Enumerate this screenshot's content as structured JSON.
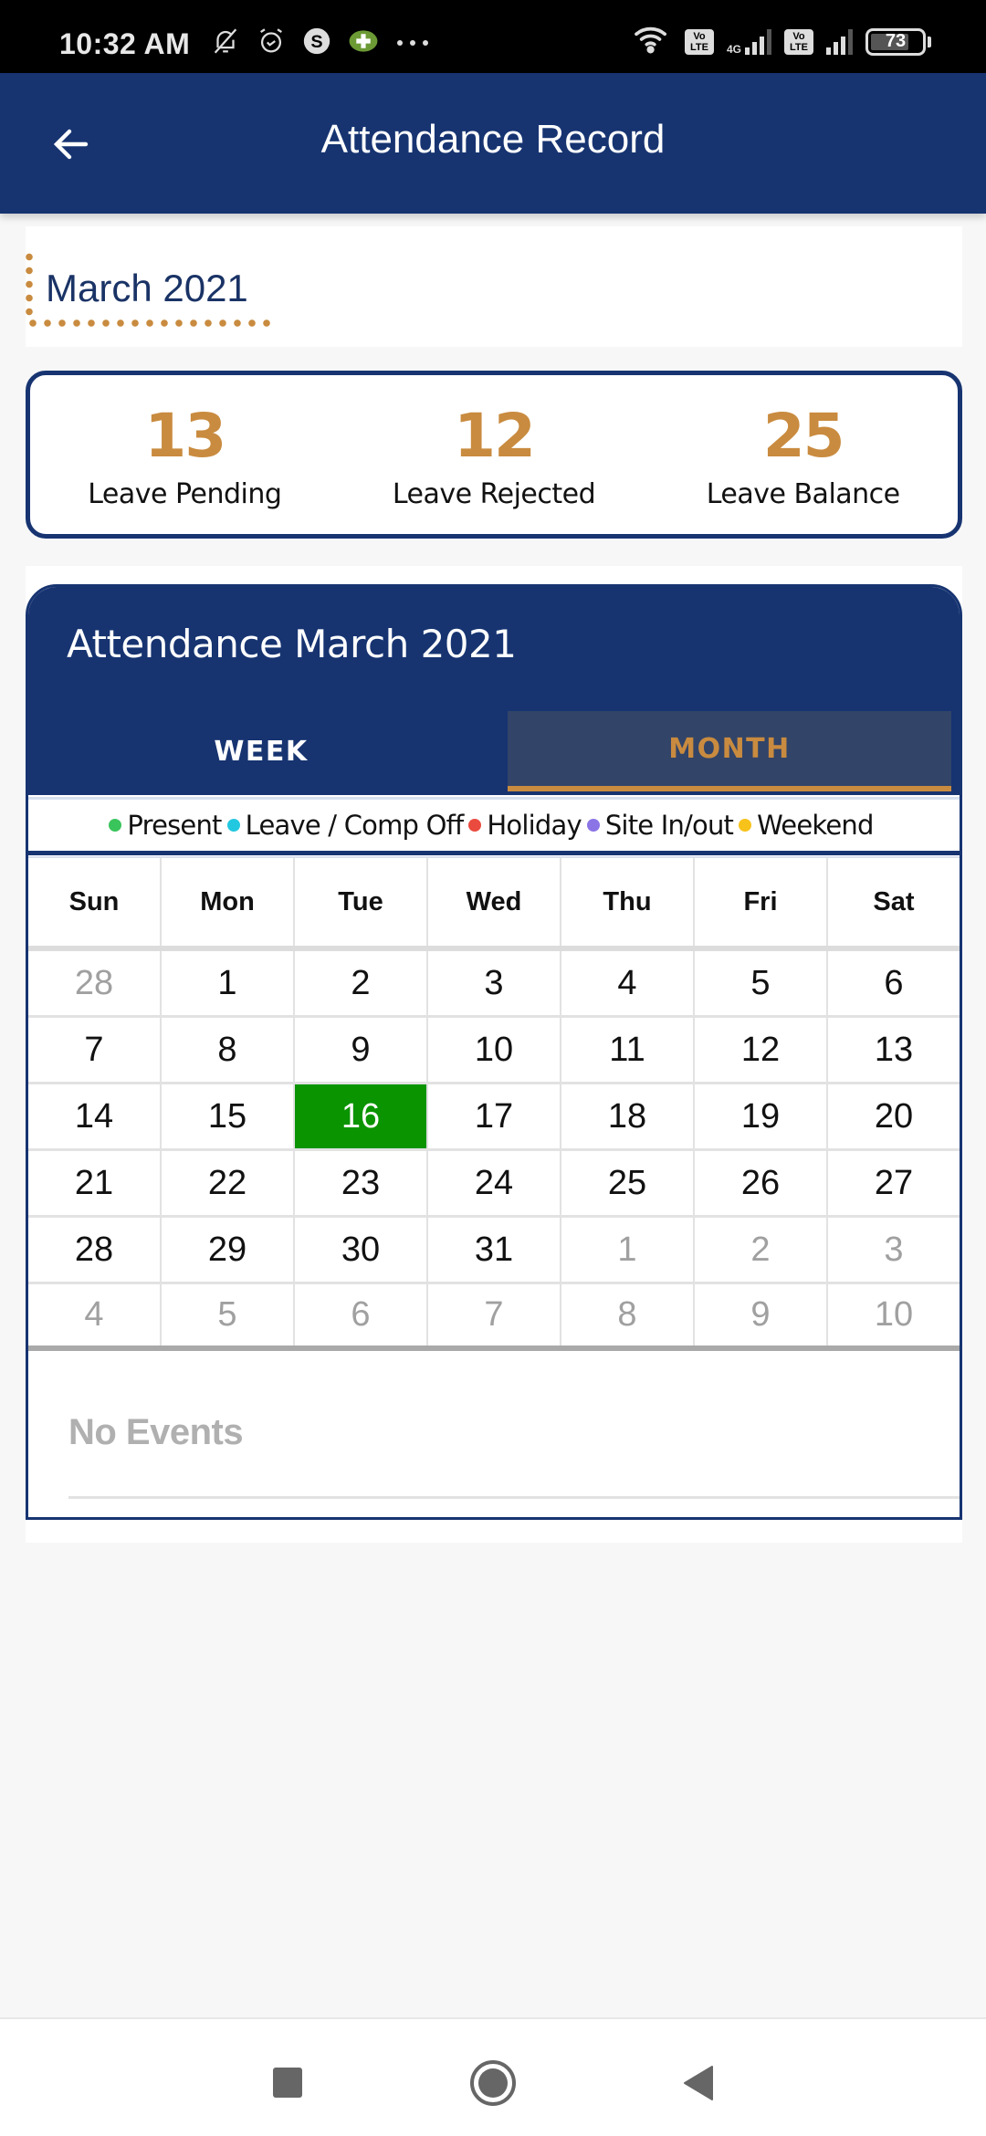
{
  "status_bar": {
    "time": "10:32 AM",
    "left_icons": [
      "bell-off-icon",
      "alarm-icon",
      "skype-icon",
      "app-notification-icon",
      "more-dots-icon"
    ],
    "right_icons": [
      "wifi-icon",
      "volte-icon",
      "4g-signal-icon",
      "volte-icon",
      "signal-icon",
      "battery-icon"
    ],
    "volte_label": "Vo LTE",
    "network_label": "4G",
    "battery_percent": "73"
  },
  "app_bar": {
    "title": "Attendance Record",
    "back_icon": "arrow-left-icon"
  },
  "month_heading": {
    "label": "March 2021"
  },
  "summary": [
    {
      "value": "13",
      "label": "Leave Pending"
    },
    {
      "value": "12",
      "label": "Leave Rejected"
    },
    {
      "value": "25",
      "label": "Leave Balance"
    }
  ],
  "attendance": {
    "title": "Attendance March 2021",
    "tabs": [
      {
        "label": "WEEK",
        "active": false
      },
      {
        "label": "MONTH",
        "active": true
      }
    ],
    "legend": [
      {
        "label": "Present",
        "color": "#3ac45c"
      },
      {
        "label": "Leave / Comp Off",
        "color": "#22c8e0"
      },
      {
        "label": "Holiday",
        "color": "#ea4b3e"
      },
      {
        "label": "Site In/out",
        "color": "#8b74e6"
      },
      {
        "label": "Weekend",
        "color": "#f7c21a"
      }
    ],
    "weekdays": [
      "Sun",
      "Mon",
      "Tue",
      "Wed",
      "Thu",
      "Fri",
      "Sat"
    ],
    "weeks": [
      [
        {
          "d": "28",
          "m": true
        },
        {
          "d": "1"
        },
        {
          "d": "2"
        },
        {
          "d": "3"
        },
        {
          "d": "4"
        },
        {
          "d": "5"
        },
        {
          "d": "6"
        }
      ],
      [
        {
          "d": "7"
        },
        {
          "d": "8"
        },
        {
          "d": "9"
        },
        {
          "d": "10"
        },
        {
          "d": "11"
        },
        {
          "d": "12"
        },
        {
          "d": "13"
        }
      ],
      [
        {
          "d": "14"
        },
        {
          "d": "15"
        },
        {
          "d": "16",
          "today": true
        },
        {
          "d": "17"
        },
        {
          "d": "18"
        },
        {
          "d": "19"
        },
        {
          "d": "20"
        }
      ],
      [
        {
          "d": "21"
        },
        {
          "d": "22"
        },
        {
          "d": "23"
        },
        {
          "d": "24"
        },
        {
          "d": "25"
        },
        {
          "d": "26"
        },
        {
          "d": "27"
        }
      ],
      [
        {
          "d": "28"
        },
        {
          "d": "29"
        },
        {
          "d": "30"
        },
        {
          "d": "31"
        },
        {
          "d": "1",
          "m": true
        },
        {
          "d": "2",
          "m": true
        },
        {
          "d": "3",
          "m": true
        }
      ],
      [
        {
          "d": "4",
          "m": true
        },
        {
          "d": "5",
          "m": true
        },
        {
          "d": "6",
          "m": true
        },
        {
          "d": "7",
          "m": true
        },
        {
          "d": "8",
          "m": true
        },
        {
          "d": "9",
          "m": true
        },
        {
          "d": "10",
          "m": true
        }
      ]
    ],
    "selected_day": "16",
    "selected_color": "#0a9400",
    "events_empty_label": "No Events"
  },
  "nav_bar": {
    "buttons": [
      "recents-square-icon",
      "home-circle-icon",
      "back-triangle-icon"
    ]
  },
  "colors": {
    "primary": "#173471",
    "accent": "#c98b3f",
    "tab_active_bg": "#324468"
  }
}
